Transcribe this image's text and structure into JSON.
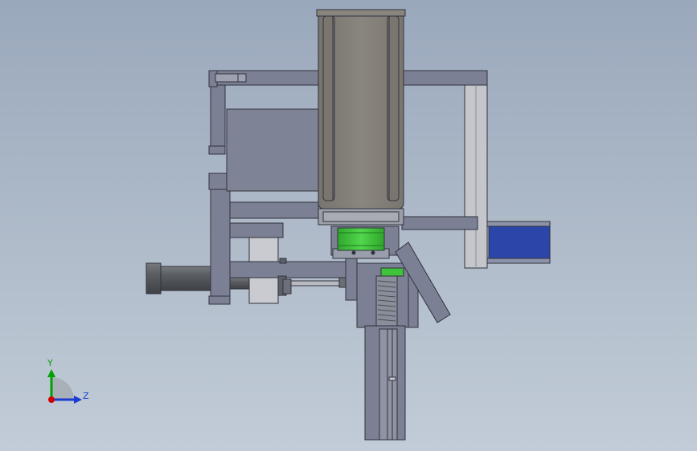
{
  "view": {
    "background_top": "#9aa8bc",
    "background_bottom": "#c2ccd8"
  },
  "triad": {
    "y_label": "Y",
    "z_label": "Z",
    "y_color": "#00a000",
    "z_color": "#1a3cd0",
    "x_color": "#d00000"
  },
  "colors": {
    "part_fill": "#7c8094",
    "part_stroke": "#30323c",
    "motor_fill": "#86827c",
    "coupling_fill": "#3ec33a",
    "blue_block": "#2b45a8",
    "light_part": "#c9cbd0",
    "cylinder": "#595d62"
  }
}
